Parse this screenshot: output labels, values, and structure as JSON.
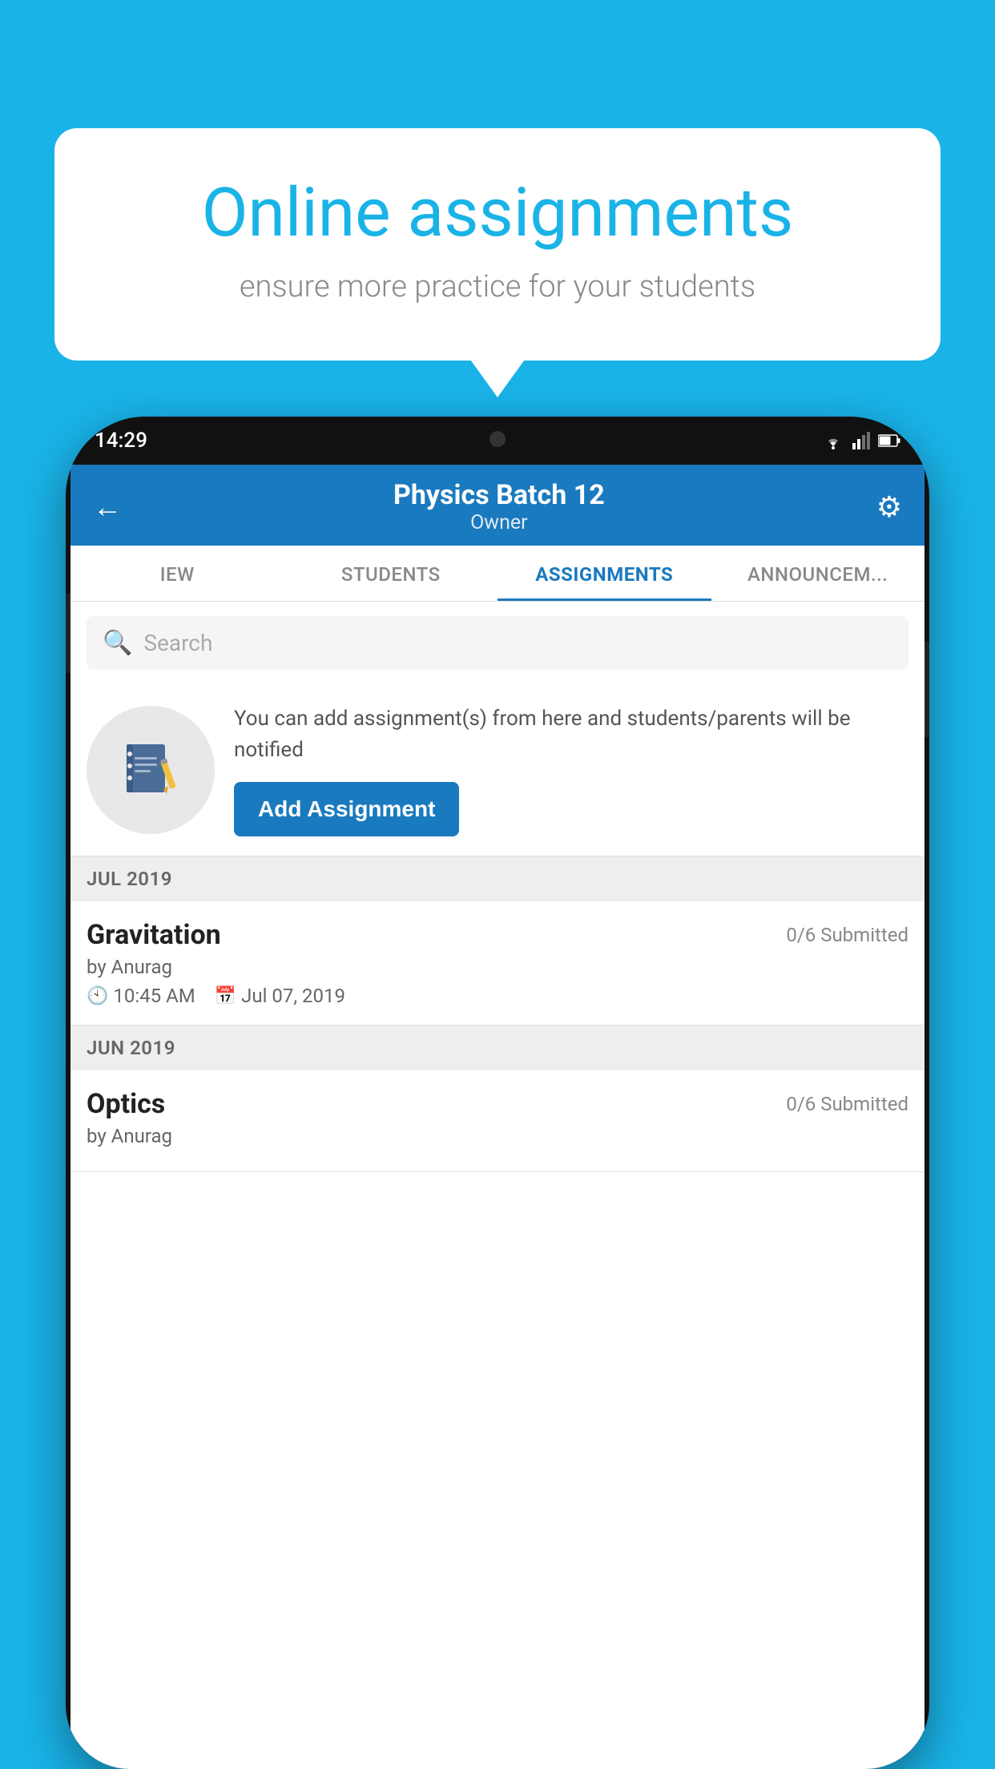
{
  "background_color": "#1ab3e8",
  "speech_bubble": {
    "title": "Online assignments",
    "subtitle": "ensure more practice for your students"
  },
  "phone": {
    "time": "14:29",
    "header": {
      "title": "Physics Batch 12",
      "subtitle": "Owner",
      "back_label": "←",
      "gear_label": "⚙"
    },
    "tabs": [
      {
        "label": "IEW",
        "active": false
      },
      {
        "label": "STUDENTS",
        "active": false
      },
      {
        "label": "ASSIGNMENTS",
        "active": true
      },
      {
        "label": "ANNOUNCEM...",
        "active": false
      }
    ],
    "search": {
      "placeholder": "Search"
    },
    "promo": {
      "text": "You can add assignment(s) from here and students/parents will be notified",
      "button_label": "Add Assignment"
    },
    "sections": [
      {
        "month": "JUL 2019",
        "assignments": [
          {
            "name": "Gravitation",
            "submitted": "0/6 Submitted",
            "author": "by Anurag",
            "time": "10:45 AM",
            "date": "Jul 07, 2019"
          }
        ]
      },
      {
        "month": "JUN 2019",
        "assignments": [
          {
            "name": "Optics",
            "submitted": "0/6 Submitted",
            "author": "by Anurag",
            "time": "",
            "date": ""
          }
        ]
      }
    ]
  }
}
